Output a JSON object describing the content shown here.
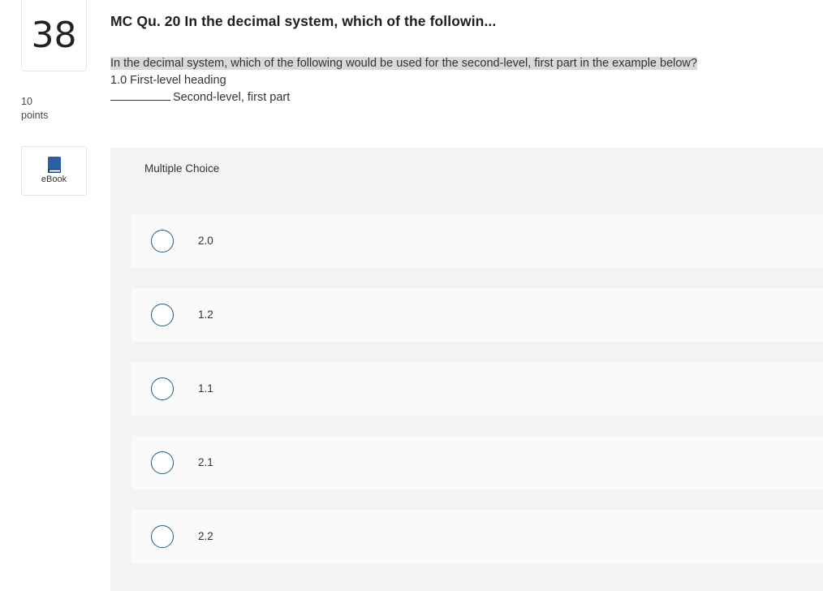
{
  "question": {
    "number": "38",
    "points_value": "10",
    "points_label": "points",
    "title": "MC Qu. 20 In the decimal system, which of the followin...",
    "prompt": {
      "line1": "In the decimal system, which of the following would be used for the second-level, first part in the example below?",
      "line2": "1.0 First-level heading",
      "line3": "Second-level, first part"
    }
  },
  "ebook": {
    "label": "eBook",
    "icon": "book-icon",
    "icon_color": "#2b5fa4"
  },
  "choices": {
    "header": "Multiple Choice",
    "options": [
      {
        "label": "2.0"
      },
      {
        "label": "1.2"
      },
      {
        "label": "1.1"
      },
      {
        "label": "2.1"
      },
      {
        "label": "2.2"
      }
    ]
  },
  "colors": {
    "radio_border": "#1d5f86",
    "panel_bg": "#f3f3f3",
    "option_bg": "#fafafa",
    "highlight": "#d9d9d9"
  }
}
